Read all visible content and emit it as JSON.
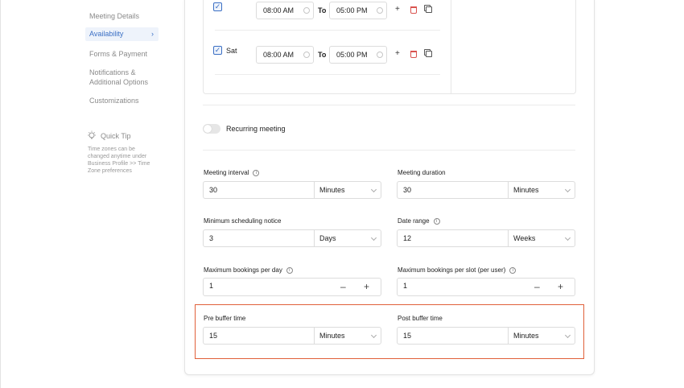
{
  "sidebar": {
    "items": [
      {
        "label": "Meeting Details"
      },
      {
        "label": "Availability",
        "active": true
      },
      {
        "label": "Forms & Payment"
      },
      {
        "label": "Notifications & Additional Options"
      },
      {
        "label": "Customizations"
      }
    ],
    "active_chevron": "›",
    "quick_tip": {
      "title": "Quick Tip",
      "text": "Time zones can be changed anytime under Business Profile >> Time Zone preferences"
    }
  },
  "schedule": {
    "rows": [
      {
        "day": "",
        "checked": true,
        "start": "08:00 AM",
        "to": "To",
        "end": "05:00 PM"
      },
      {
        "day": "Sat",
        "checked": true,
        "start": "08:00 AM",
        "to": "To",
        "end": "05:00 PM"
      }
    ],
    "icons": {
      "add": "plus-icon",
      "delete": "trash-icon",
      "copy": "copy-icon"
    }
  },
  "recurring": {
    "label": "Recurring meeting",
    "enabled": false
  },
  "fields": {
    "meeting_interval": {
      "label": "Meeting interval",
      "value": "30",
      "unit": "Minutes"
    },
    "meeting_duration": {
      "label": "Meeting duration",
      "value": "30",
      "unit": "Minutes"
    },
    "min_notice": {
      "label": "Minimum scheduling notice",
      "value": "3",
      "unit": "Days"
    },
    "date_range": {
      "label": "Date range",
      "value": "12",
      "unit": "Weeks"
    },
    "max_per_day": {
      "label": "Maximum bookings per day",
      "value": "1",
      "minus": "–",
      "plus": "+"
    },
    "max_per_slot": {
      "label": "Maximum bookings per slot (per user)",
      "value": "1",
      "minus": "–",
      "plus": "+"
    },
    "pre_buffer": {
      "label": "Pre buffer time",
      "value": "15",
      "unit": "Minutes"
    },
    "post_buffer": {
      "label": "Post buffer time",
      "value": "15",
      "unit": "Minutes"
    }
  },
  "colors": {
    "accent": "#3b6fc4",
    "highlight": "#e0603a",
    "delete": "#d9534f"
  }
}
